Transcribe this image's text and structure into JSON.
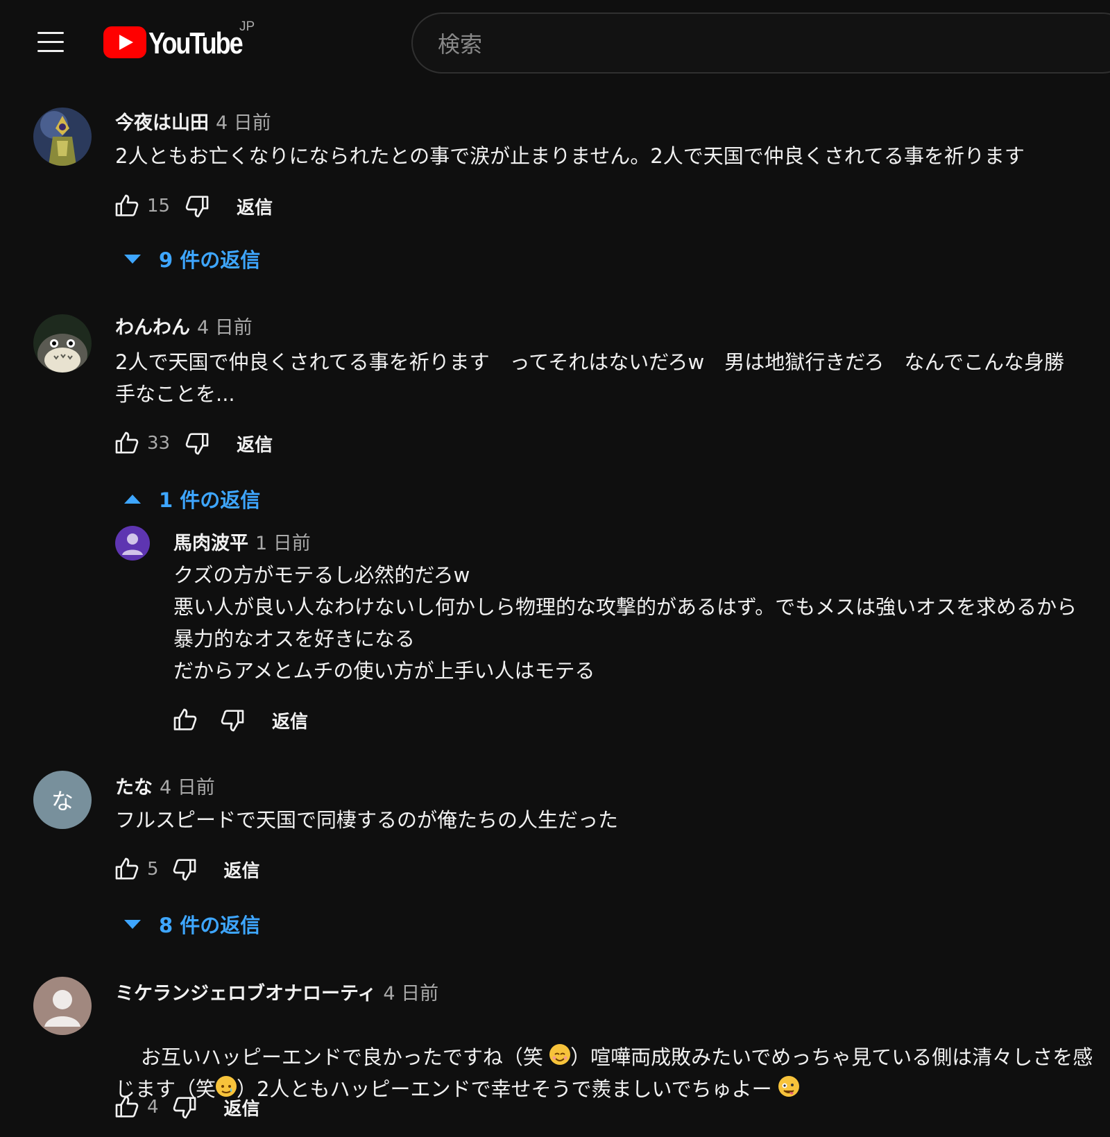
{
  "header": {
    "logo_text": "YouTube",
    "logo_region": "JP",
    "search_placeholder": "検索"
  },
  "comments": [
    {
      "author": "今夜は山田",
      "time": "4 日前",
      "text": "2人ともお亡くなりになられたとの事で涙が止まりません。2人で天国で仲良くされてる事を祈ります",
      "likes": "15",
      "reply_label": "返信",
      "replies_label": "9 件の返信"
    },
    {
      "author": "わんわん",
      "time": "4 日前",
      "text": "2人で天国で仲良くされてる事を祈ります　ってそれはないだろw　男は地獄行きだろ　なんでこんな身勝\n手なことを...",
      "likes": "33",
      "reply_label": "返信",
      "replies_label": "1 件の返信"
    },
    {
      "author": "たな",
      "avatar_letter": "な",
      "time": "4 日前",
      "text": "フルスピードで天国で同棲するのが俺たちの人生だった",
      "likes": "5",
      "reply_label": "返信",
      "replies_label": "8 件の返信"
    },
    {
      "author": "ミケランジェロブオナローティ",
      "time": "4 日前",
      "text_line1_a": "お互いハッピーエンドで良かったですね（笑 ",
      "text_line1_b": "）喧嘩両成敗みたいでめっちゃ見ている側は清々しさを感",
      "text_line2_a": "じます（笑",
      "text_line2_b": "）2人ともハッピーエンドで幸せそうで羨ましいでちゅよー ",
      "likes": "4",
      "reply_label": "返信"
    }
  ],
  "reply": {
    "author": "馬肉波平",
    "time": "1 日前",
    "text": "クズの方がモテるし必然的だろw\n悪い人が良い人なわけないし何かしら物理的な攻撃的があるはず。でもメスは強いオスを求めるから\n暴力的なオスを好きになる\nだからアメとムチの使い方が上手い人はモテる",
    "reply_label": "返信"
  },
  "colors": {
    "background": "#0f0f0f",
    "link_blue": "#3ea6ff",
    "brand_red": "#ff0000",
    "muted": "#aaaaaa"
  }
}
